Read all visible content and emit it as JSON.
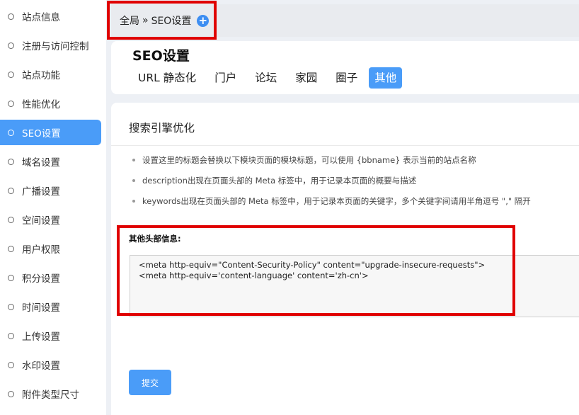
{
  "sidebar": {
    "items": [
      {
        "label": "站点信息"
      },
      {
        "label": "注册与访问控制"
      },
      {
        "label": "站点功能"
      },
      {
        "label": "性能优化"
      },
      {
        "label": "SEO设置"
      },
      {
        "label": "域名设置"
      },
      {
        "label": "广播设置"
      },
      {
        "label": "空间设置"
      },
      {
        "label": "用户权限"
      },
      {
        "label": "积分设置"
      },
      {
        "label": "时间设置"
      },
      {
        "label": "上传设置"
      },
      {
        "label": "水印设置"
      },
      {
        "label": "附件类型尺寸"
      }
    ],
    "active_label": "SEO设置"
  },
  "breadcrumb": {
    "root": "全局",
    "separator": "»",
    "current": "SEO设置",
    "add_icon": "plus-circle-icon"
  },
  "header": {
    "title": "SEO设置",
    "tabs": [
      {
        "label": "URL 静态化"
      },
      {
        "label": "门户"
      },
      {
        "label": "论坛"
      },
      {
        "label": "家园"
      },
      {
        "label": "圈子"
      },
      {
        "label": "其他"
      }
    ],
    "active_tab": "其他"
  },
  "content": {
    "section_title": "搜索引擎优化",
    "tips": [
      "设置这里的标题会替换以下模块页面的模块标题，可以使用 {bbname} 表示当前的站点名称",
      "description出现在页面头部的 Meta 标签中，用于记录本页面的概要与描述",
      "keywords出现在页面头部的 Meta 标签中，用于记录本页面的关键字，多个关键字间请用半角逗号 \",\" 隔开"
    ],
    "field_label": "其他头部信息:",
    "field_value": "<meta http-equiv=\"Content-Security-Policy\" content=\"upgrade-insecure-requests\">\n<meta http-equiv='content-language' content='zh-cn'>",
    "submit_label": "提交"
  },
  "colors": {
    "accent": "#4a9cf8",
    "highlight_box": "#e00000",
    "background": "#edf0f5"
  }
}
